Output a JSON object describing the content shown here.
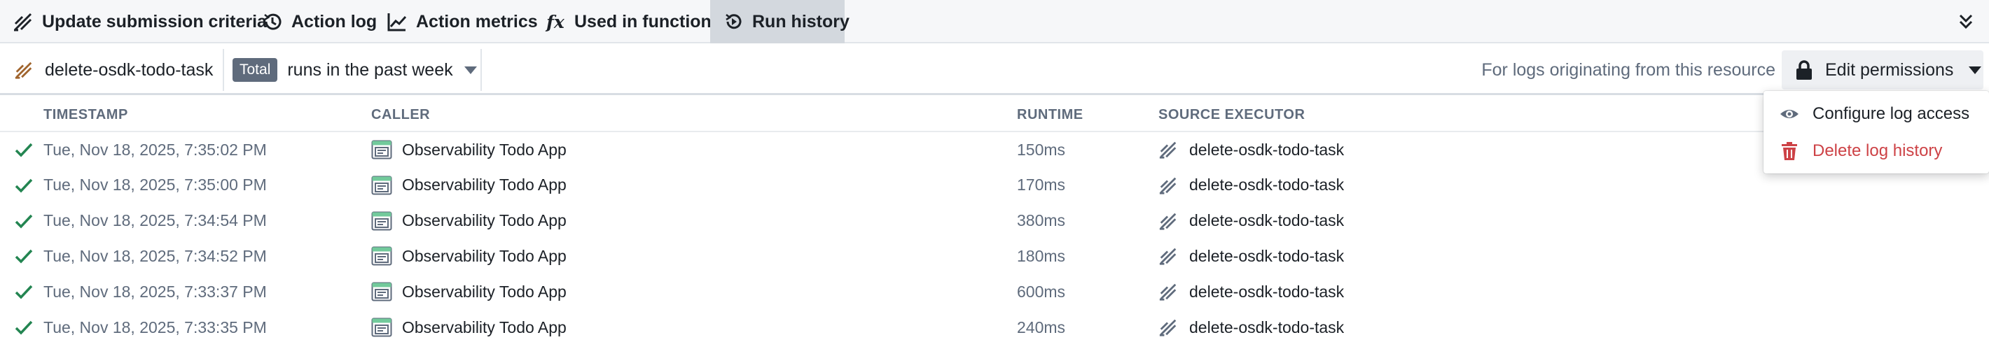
{
  "tabs": [
    {
      "label": "Update submission criteria",
      "icon": "criteria-icon",
      "active": false
    },
    {
      "label": "Action log",
      "icon": "history-icon",
      "active": false
    },
    {
      "label": "Action metrics",
      "icon": "line-chart-icon",
      "active": false
    },
    {
      "label": "Used in functions",
      "icon": "function-icon",
      "fx_glyph": "fx",
      "active": false
    },
    {
      "label": "Run history",
      "icon": "run-history-icon",
      "active": true
    }
  ],
  "filters": {
    "resource": "delete-osdk-todo-task",
    "badge": "Total",
    "range_label": "runs in the past week",
    "logs_note": "For logs originating from this resource",
    "permissions_label": "Edit permissions"
  },
  "columns": {
    "timestamp": "TIMESTAMP",
    "caller": "CALLER",
    "runtime": "RUNTIME",
    "source_executor": "SOURCE EXECUTOR"
  },
  "rows": [
    {
      "timestamp": "Tue, Nov 18, 2025, 7:35:02 PM",
      "caller": "Observability Todo App",
      "runtime": "150ms",
      "executor": "delete-osdk-todo-task",
      "status": "success"
    },
    {
      "timestamp": "Tue, Nov 18, 2025, 7:35:00 PM",
      "caller": "Observability Todo App",
      "runtime": "170ms",
      "executor": "delete-osdk-todo-task",
      "status": "success"
    },
    {
      "timestamp": "Tue, Nov 18, 2025, 7:34:54 PM",
      "caller": "Observability Todo App",
      "runtime": "380ms",
      "executor": "delete-osdk-todo-task",
      "status": "success"
    },
    {
      "timestamp": "Tue, Nov 18, 2025, 7:34:52 PM",
      "caller": "Observability Todo App",
      "runtime": "180ms",
      "executor": "delete-osdk-todo-task",
      "status": "success"
    },
    {
      "timestamp": "Tue, Nov 18, 2025, 7:33:37 PM",
      "caller": "Observability Todo App",
      "runtime": "600ms",
      "executor": "delete-osdk-todo-task",
      "status": "success"
    },
    {
      "timestamp": "Tue, Nov 18, 2025, 7:33:35 PM",
      "caller": "Observability Todo App",
      "runtime": "240ms",
      "executor": "delete-osdk-todo-task",
      "status": "success"
    }
  ],
  "menu": {
    "configure_label": "Configure log access",
    "delete_label": "Delete log history"
  },
  "colors": {
    "success": "#238551",
    "danger": "#cd4246",
    "active_tab": "#d3d8de",
    "muted_text": "#5f6b7c"
  }
}
